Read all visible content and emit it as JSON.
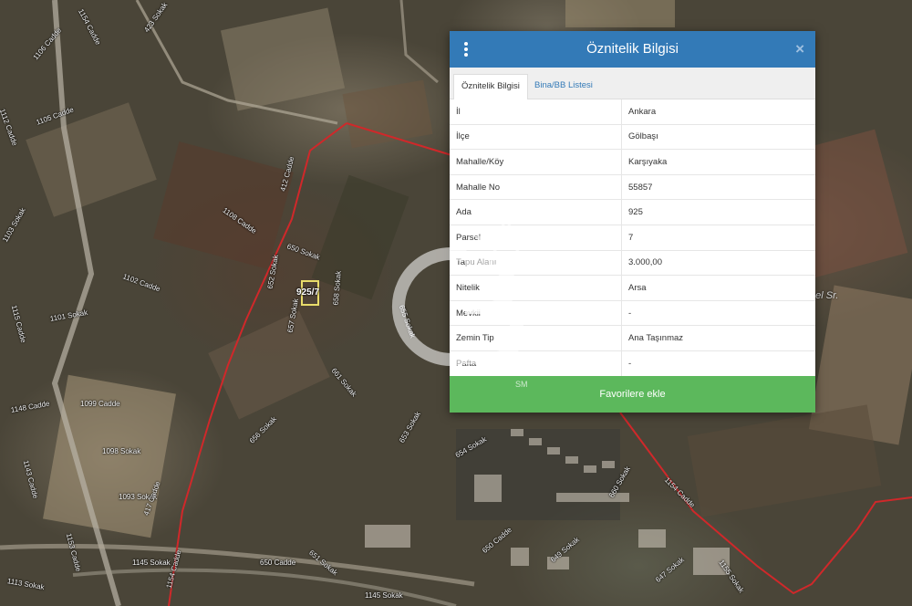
{
  "map": {
    "parcel_label": "925/7",
    "right_label": "bel Sr.",
    "streets": [
      {
        "text": "1154 Cadde"
      },
      {
        "text": "1106 Cadde"
      },
      {
        "text": "423 Sokak"
      },
      {
        "text": "1112 Cadde"
      },
      {
        "text": "1105 Cadde"
      },
      {
        "text": "1103 Sokak"
      },
      {
        "text": "1108 Cadde"
      },
      {
        "text": "1102 Cadde"
      },
      {
        "text": "1101 Sokak"
      },
      {
        "text": "1115 Cadde"
      },
      {
        "text": "412 Cadde"
      },
      {
        "text": "650 Sokak"
      },
      {
        "text": "652 Sokak"
      },
      {
        "text": "657 Sokak"
      },
      {
        "text": "658 Sokak"
      },
      {
        "text": "655 Sokak"
      },
      {
        "text": "661 Sokak"
      },
      {
        "text": "656 Sokak"
      },
      {
        "text": "1099 Cadde"
      },
      {
        "text": "1148 Cadde"
      },
      {
        "text": "1098 Sokak"
      },
      {
        "text": "1143 Cadde"
      },
      {
        "text": "1093 Sokak"
      },
      {
        "text": "1145 Sokak"
      },
      {
        "text": "417 Cadde"
      },
      {
        "text": "651 Sokak"
      },
      {
        "text": "650 Cadde"
      },
      {
        "text": "1153 Cadde"
      },
      {
        "text": "1154 Cadde"
      },
      {
        "text": "653 Sokak"
      },
      {
        "text": "654 Sokak"
      },
      {
        "text": "649 Sokak"
      },
      {
        "text": "660 Sokak"
      },
      {
        "text": "647 Sokak"
      },
      {
        "text": "1154 Cadde"
      },
      {
        "text": "1155 Sokak"
      },
      {
        "text": "1113 Sokak"
      },
      {
        "text": "650 Cadde"
      },
      {
        "text": "1145 Sokak"
      }
    ]
  },
  "dialog": {
    "title": "Öznitelik Bilgisi",
    "close": "×",
    "tabs": [
      "Öznitelik Bilgisi",
      "Bina/BB Listesi"
    ],
    "rows": [
      {
        "key": "İl",
        "value": "Ankara"
      },
      {
        "key": "İlçe",
        "value": "Gölbaşı"
      },
      {
        "key": "Mahalle/Köy",
        "value": "Karşıyaka"
      },
      {
        "key": "Mahalle No",
        "value": "55857"
      },
      {
        "key": "Ada",
        "value": "925"
      },
      {
        "key": "Parsel",
        "value": "7"
      },
      {
        "key": "Tapu Alanı",
        "value": "3.000,00"
      },
      {
        "key": "Nitelik",
        "value": "Arsa"
      },
      {
        "key": "Mevkii",
        "value": "-"
      },
      {
        "key": "Zemin Tip",
        "value": "Ana Taşınmaz"
      },
      {
        "key": "Pafta",
        "value": "-"
      }
    ],
    "favorite_button": "Favorilere ekle"
  },
  "watermark": {
    "text": "SM"
  },
  "colors": {
    "header": "#337ab7",
    "button": "#5cb85c",
    "border_line": "#d0282a",
    "parcel": "#e8dc6a"
  }
}
